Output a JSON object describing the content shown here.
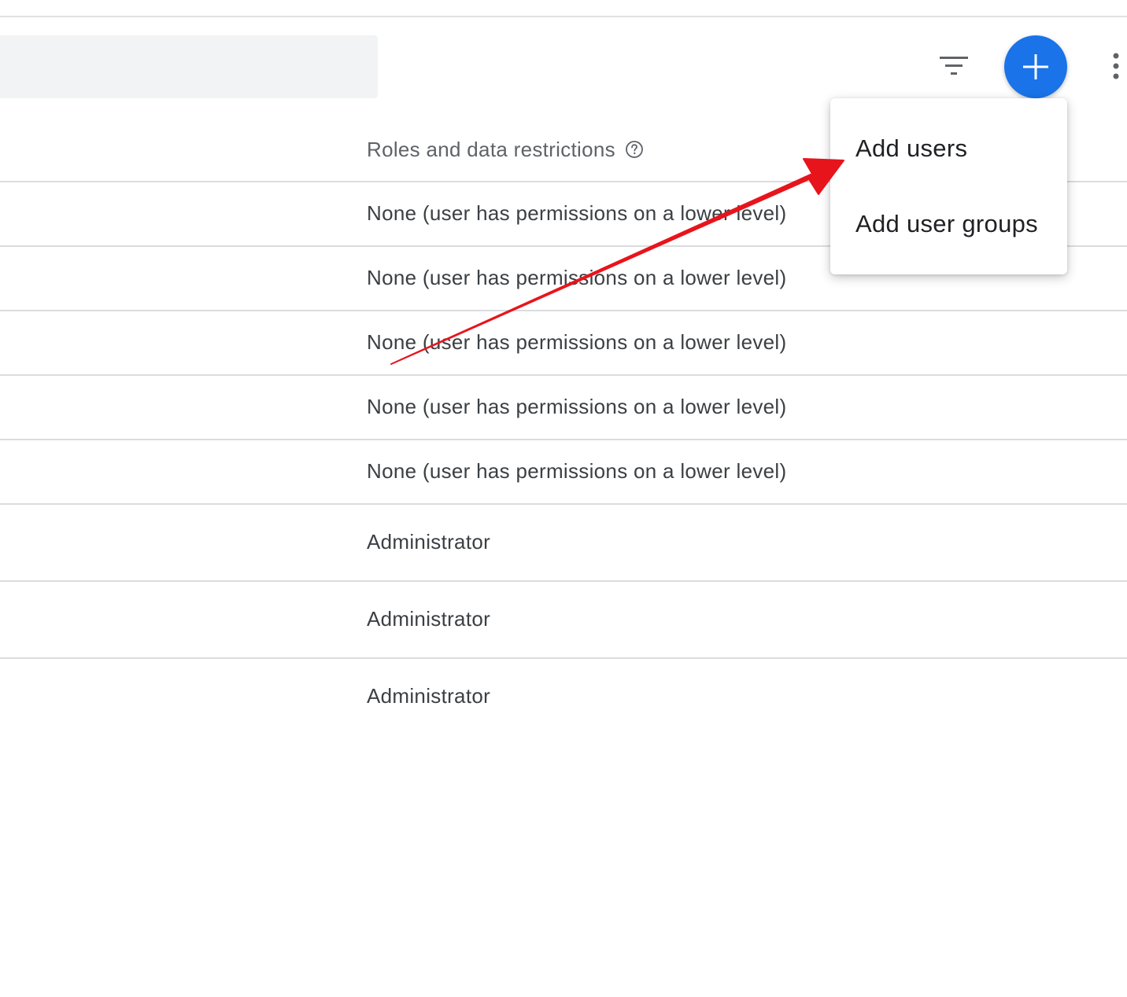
{
  "toolbar": {
    "search_placeholder": "",
    "filter_icon": "filter-list-icon",
    "add_icon": "plus-icon",
    "more_icon": "more-vert-icon",
    "accent_color": "#1a73e8"
  },
  "table": {
    "column_header": "Roles and data restrictions",
    "help_icon": "help-circle-icon",
    "rows": [
      "None (user has permissions on a lower level)",
      "None (user has permissions on a lower level)",
      "None (user has permissions on a lower level)",
      "None (user has permissions on a lower level)",
      "None (user has permissions on a lower level)",
      "Administrator",
      "Administrator",
      "Administrator"
    ]
  },
  "add_menu": {
    "items": [
      "Add users",
      "Add user groups"
    ]
  },
  "annotation": {
    "arrow_color": "#e8141c"
  }
}
